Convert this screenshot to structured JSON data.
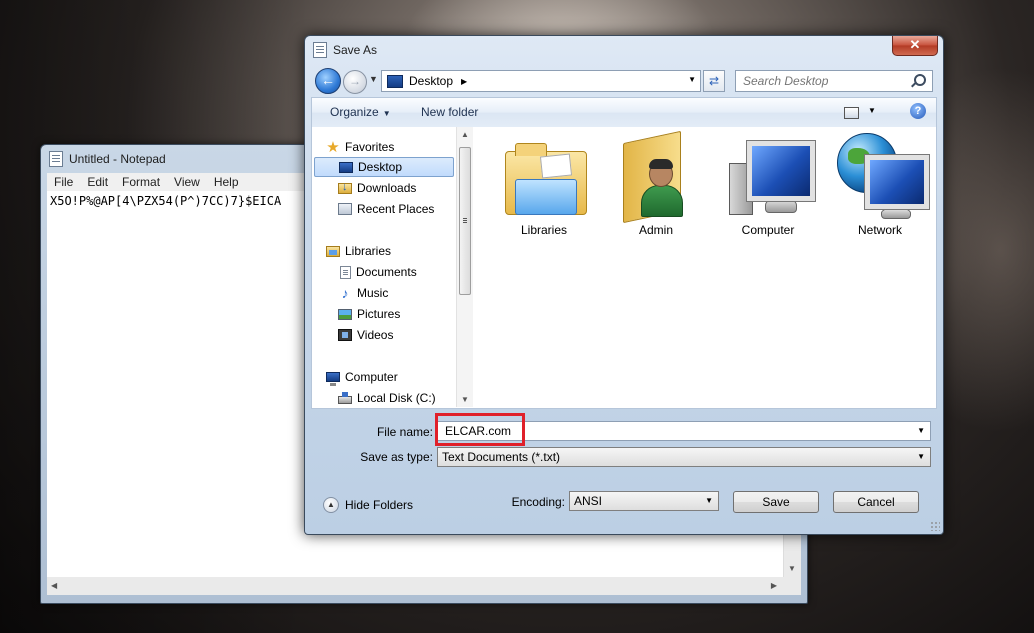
{
  "notepad": {
    "title": "Untitled - Notepad",
    "menu": [
      "File",
      "Edit",
      "Format",
      "View",
      "Help"
    ],
    "content": "X5O!P%@AP[4\\PZX54(P^)7CC)7}$EICA"
  },
  "dialog": {
    "title": "Save As",
    "close_label": "✕",
    "address": {
      "location": "Desktop"
    },
    "search": {
      "placeholder": "Search Desktop"
    },
    "toolbar": {
      "organize": "Organize",
      "new_folder": "New folder",
      "help": "?"
    },
    "nav_groups": {
      "favorites": {
        "label": "Favorites",
        "items": [
          "Desktop",
          "Downloads",
          "Recent Places"
        ],
        "selected": "Desktop"
      },
      "libraries": {
        "label": "Libraries",
        "items": [
          "Documents",
          "Music",
          "Pictures",
          "Videos"
        ]
      },
      "computer": {
        "label": "Computer",
        "items": [
          "Local Disk (C:)"
        ]
      }
    },
    "files": [
      "Libraries",
      "Admin",
      "Computer",
      "Network"
    ],
    "file_name": {
      "label": "File name:",
      "value": "ELCAR.com"
    },
    "save_as_type": {
      "label": "Save as type:",
      "value": "Text Documents (*.txt)"
    },
    "hide_folders": "Hide Folders",
    "encoding": {
      "label": "Encoding:",
      "value": "ANSI"
    },
    "buttons": {
      "save": "Save",
      "cancel": "Cancel"
    },
    "highlight_color": "#e0202a"
  }
}
